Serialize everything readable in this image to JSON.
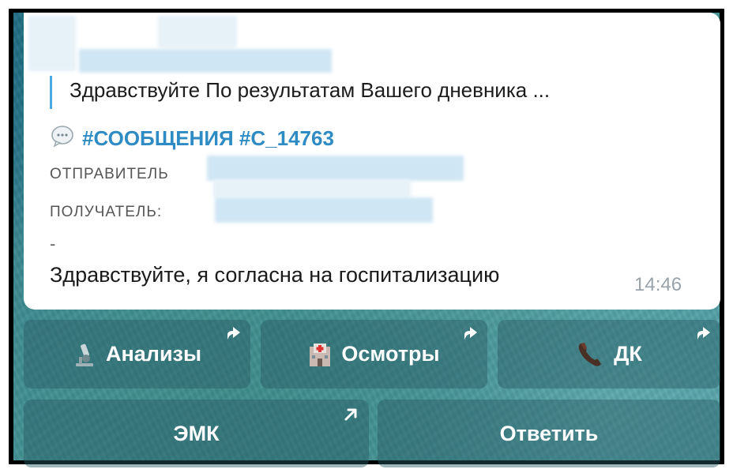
{
  "message": {
    "reply_preview": "Здравствуйте  По результатам Вашего дневника ...",
    "tags": "#СООБЩЕНИЯ #С_14763",
    "sender_label": "ОТПРАВИТЕЛЬ",
    "recipient_label": "ПОЛУЧАТЕЛЬ:",
    "dash": "-",
    "text": "Здравствуйте,  я согласна на госпитализацию",
    "time": "14:46"
  },
  "keyboard": {
    "row1": [
      {
        "label": "Анализы",
        "icon": "microscope-icon"
      },
      {
        "label": "Осмотры",
        "icon": "hospital-icon"
      },
      {
        "label": "ДК",
        "icon": "phone-icon"
      }
    ],
    "row2": [
      {
        "label": "ЭМК"
      },
      {
        "label": "Ответить"
      }
    ]
  },
  "colors": {
    "accent": "#2e8bc4",
    "reply_bar": "#4aa8e4",
    "button_bg": "#2f6a74"
  }
}
